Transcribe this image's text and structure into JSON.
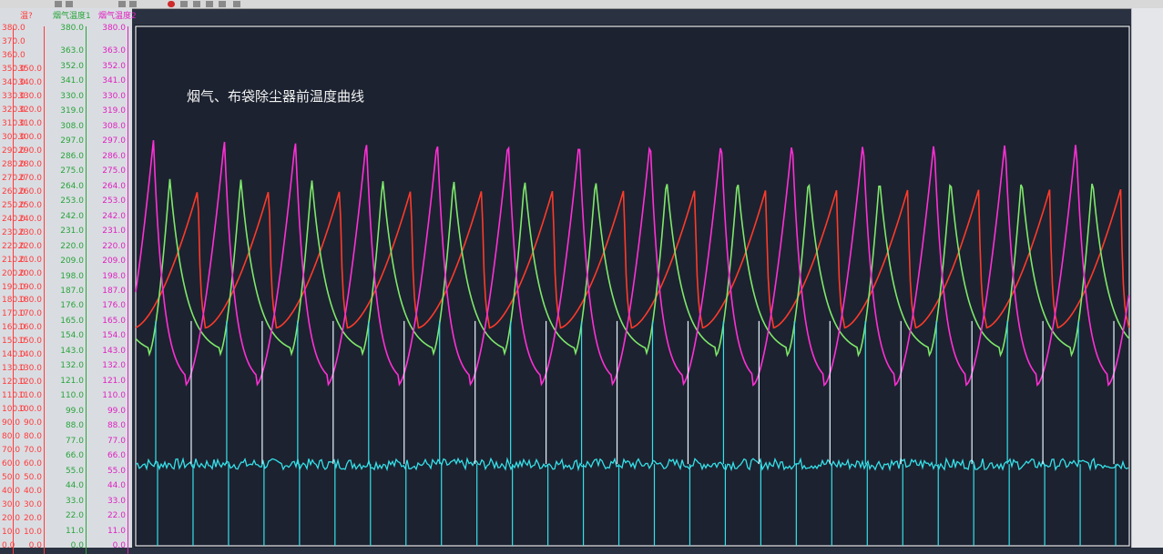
{
  "chart_data": {
    "type": "line",
    "title": "烟气、布袋除尘器前温度曲线",
    "axes": [
      {
        "name": "axis-1",
        "label": "",
        "color": "#ff3b3b",
        "range": [
          0,
          380
        ],
        "ticks": [
          "0.0",
          "10.0",
          "20.0",
          "30.0",
          "40.0",
          "50.0",
          "60.0",
          "70.0",
          "80.0",
          "90.0",
          "100.0",
          "110.0",
          "120.0",
          "130.0",
          "140.0",
          "150.0",
          "160.0",
          "170.0",
          "180.0",
          "190.0",
          "200.0",
          "210.0",
          "220.0",
          "230.0",
          "240.0",
          "250.0",
          "260.0",
          "270.0",
          "280.0",
          "290.0",
          "300.0",
          "310.0",
          "320.0",
          "330.0",
          "340.0",
          "350.0",
          "360.0",
          "370.0",
          "380.0"
        ]
      },
      {
        "name": "axis-2",
        "label": "温?",
        "color": "#ff3b3b",
        "range": [
          0,
          380
        ],
        "ticks": [
          "0.0",
          "10.0",
          "20.0",
          "30.0",
          "40.0",
          "50.0",
          "60.0",
          "70.0",
          "80.0",
          "90.0",
          "100.0",
          "110.0",
          "120.0",
          "130.0",
          "140.0",
          "150.0",
          "160.0",
          "170.0",
          "180.0",
          "190.0",
          "200.0",
          "210.0",
          "220.0",
          "230.0",
          "240.0",
          "250.0",
          "260.0",
          "270.0",
          "280.0",
          "290.0",
          "300.0",
          "310.0",
          "320.0",
          "330.0",
          "340.0",
          "350.0"
        ]
      },
      {
        "name": "axis-3",
        "label": "烟气温度1",
        "color": "#2aa43a",
        "range": [
          0,
          380
        ],
        "ticks": [
          "0.0",
          "11.0",
          "22.0",
          "33.0",
          "44.0",
          "55.0",
          "66.0",
          "77.0",
          "88.0",
          "99.0",
          "110.0",
          "121.0",
          "132.0",
          "143.0",
          "154.0",
          "165.0",
          "176.0",
          "187.0",
          "198.0",
          "209.0",
          "220.0",
          "231.0",
          "242.0",
          "253.0",
          "264.0",
          "275.0",
          "286.0",
          "297.0",
          "308.0",
          "319.0",
          "330.0",
          "341.0",
          "352.0",
          "363.0",
          "380.0"
        ]
      },
      {
        "name": "axis-4",
        "label": "烟气温度2",
        "color": "#e020c0",
        "range": [
          0,
          380
        ],
        "ticks": [
          "0.0",
          "11.0",
          "22.0",
          "33.0",
          "44.0",
          "55.0",
          "66.0",
          "77.0",
          "88.0",
          "99.0",
          "110.0",
          "121.0",
          "132.0",
          "143.0",
          "154.0",
          "165.0",
          "176.0",
          "187.0",
          "198.0",
          "209.0",
          "220.0",
          "231.0",
          "242.0",
          "253.0",
          "264.0",
          "275.0",
          "286.0",
          "297.0",
          "308.0",
          "319.0",
          "330.0",
          "341.0",
          "352.0",
          "363.0",
          "380.0"
        ]
      }
    ],
    "series": [
      {
        "color": "#ff3a2a",
        "min": 160,
        "max": 262,
        "peak_x_fraction": 0.9,
        "phase": 0.02,
        "noise": 0
      },
      {
        "color": "#7ee86a",
        "min": 140,
        "max": 270,
        "peak_x_fraction": 0.3,
        "phase": -0.18,
        "noise": 0
      },
      {
        "color": "#ff2fd6",
        "min": 118,
        "max": 298,
        "peak_x_fraction": 0.55,
        "phase": 0.3,
        "noise": 0
      },
      {
        "color": "#35e0e8",
        "min": 0,
        "max": 165,
        "baseline": 60,
        "spikes": true,
        "noise": 4
      }
    ],
    "cycles": 14,
    "grid": false,
    "legend": "none"
  }
}
